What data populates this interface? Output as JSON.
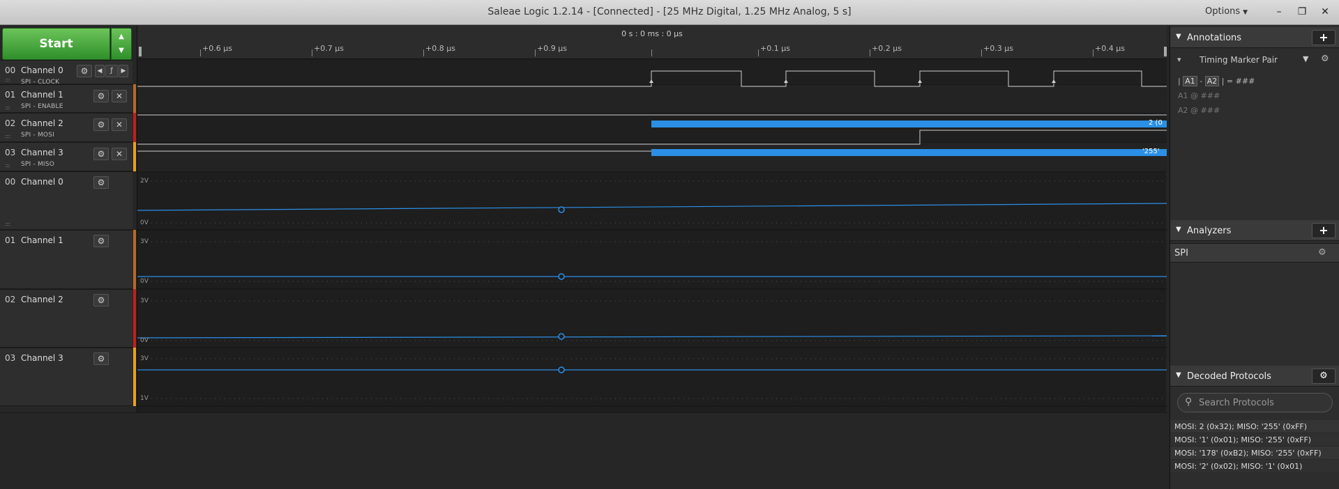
{
  "window": {
    "title": "Saleae Logic 1.2.14 - [Connected] - [25 MHz Digital, 1.25 MHz Analog, 5 s]",
    "options_label": "Options"
  },
  "toolbar": {
    "start_label": "Start"
  },
  "timeline": {
    "header": "0 s : 0 ms : 0 µs",
    "ticks": [
      "+0.6 µs",
      "+0.7 µs",
      "+0.8 µs",
      "+0.9 µs",
      "+0.1 µs",
      "+0.2 µs",
      "+0.3 µs",
      "+0.4 µs"
    ]
  },
  "channels": [
    {
      "num": "00",
      "name": "Channel 0",
      "sub": "SPI - CLOCK",
      "kind": "digital",
      "color": "#555555"
    },
    {
      "num": "01",
      "name": "Channel 1",
      "sub": "SPI - ENABLE",
      "kind": "digital",
      "color": "#b46a28"
    },
    {
      "num": "02",
      "name": "Channel 2",
      "sub": "SPI - MOSI",
      "kind": "digital",
      "color": "#c0201c"
    },
    {
      "num": "03",
      "name": "Channel 3",
      "sub": "SPI - MISO",
      "kind": "digital",
      "color": "#e8a020"
    },
    {
      "num": "00",
      "name": "Channel 0",
      "sub": "",
      "kind": "analog",
      "color": "#555555",
      "vmax": "2V",
      "vmin": "0V"
    },
    {
      "num": "01",
      "name": "Channel 1",
      "sub": "",
      "kind": "analog",
      "color": "#b46a28",
      "vmax": "3V",
      "vmin": "0V"
    },
    {
      "num": "02",
      "name": "Channel 2",
      "sub": "",
      "kind": "analog",
      "color": "#c0201c",
      "vmax": "3V",
      "vmin": "0V"
    },
    {
      "num": "03",
      "name": "Channel 3",
      "sub": "",
      "kind": "analog",
      "color": "#e8a020",
      "vmax": "3V",
      "vmin": "1V"
    }
  ],
  "decode_bubbles": {
    "mosi": "2 (0",
    "miso": "'255'"
  },
  "annotations": {
    "header": "Annotations",
    "marker_pair": "Timing Marker Pair",
    "lines": [
      "| A1 - A2 | = ###",
      "A1  @  ###",
      "A2  @  ###"
    ],
    "a1": "A1",
    "a2": "A2",
    "equals": "| = ###",
    "hash": "###",
    "at": "@"
  },
  "analyzers": {
    "header": "Analyzers",
    "items": [
      "SPI"
    ]
  },
  "decoded": {
    "header": "Decoded Protocols",
    "search_placeholder": "Search Protocols",
    "rows": [
      "MOSI: 2 (0x32);  MISO: '255' (0xFF)",
      "MOSI: '1' (0x01);  MISO: '255' (0xFF)",
      "MOSI: '178' (0xB2);  MISO: '255' (0xFF)",
      "MOSI: '2' (0x02);  MISO: '1' (0x01)"
    ]
  },
  "colors": {
    "accent": "#2b8fe6",
    "start_green": "#3f9f35"
  }
}
